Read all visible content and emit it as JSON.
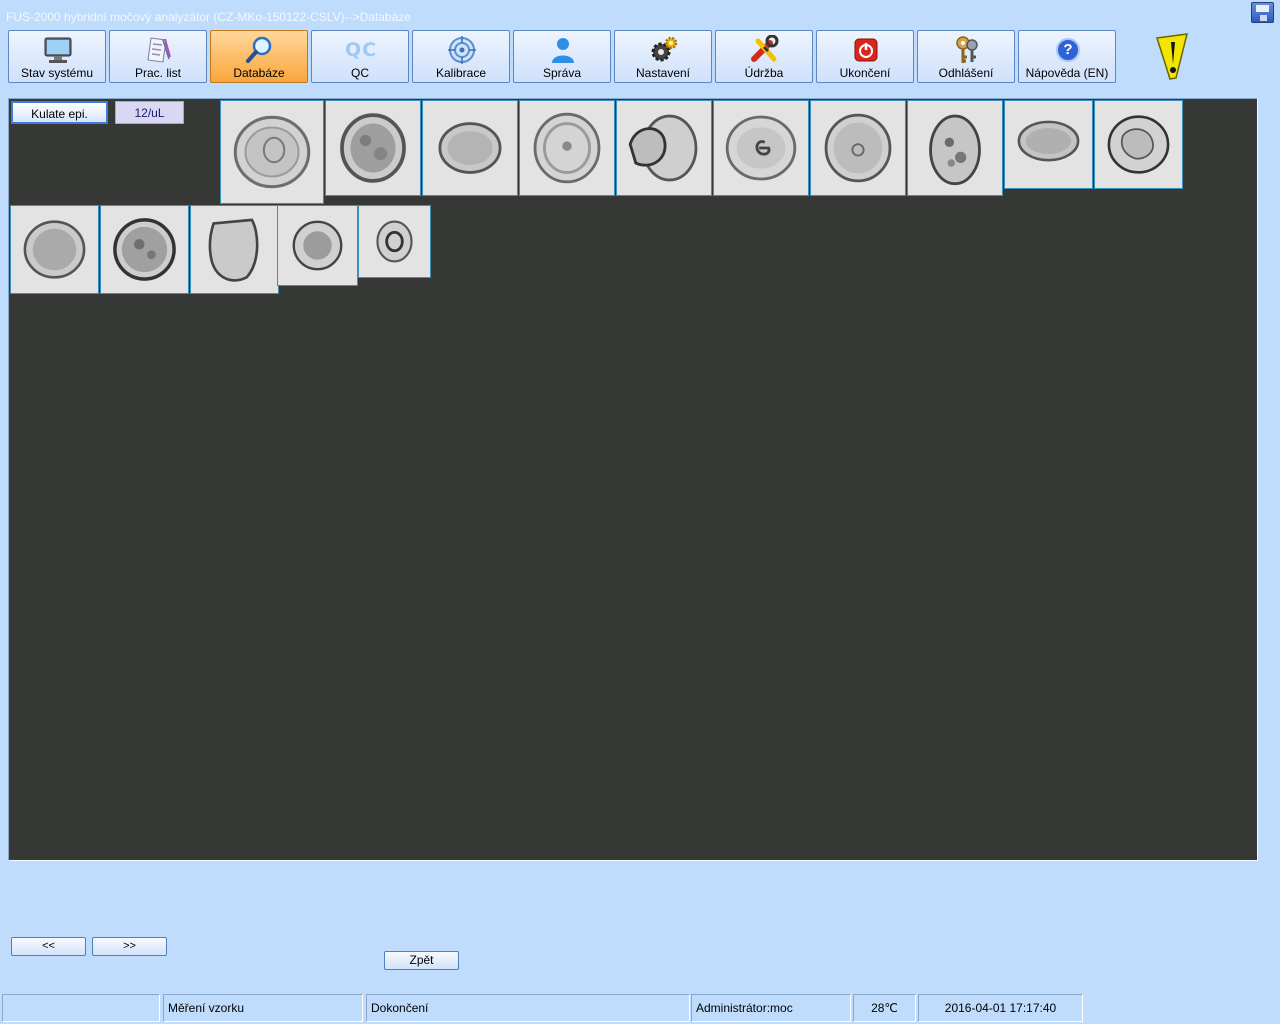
{
  "window": {
    "title": "FUS-2000 hybridní močový analyzátor (CZ-MKo-150122-CSLV)-->Databáze"
  },
  "toolbar": {
    "buttons": [
      {
        "label": "Stav systému",
        "icon": "monitor-icon"
      },
      {
        "label": "Prac. list",
        "icon": "worklist-icon"
      },
      {
        "label": "Databáze",
        "icon": "magnifier-icon",
        "active": true
      },
      {
        "label": "QC",
        "icon": "qc-icon"
      },
      {
        "label": "Kalibrace",
        "icon": "target-icon"
      },
      {
        "label": "Správa",
        "icon": "user-icon"
      },
      {
        "label": "Nastavení",
        "icon": "gears-icon"
      },
      {
        "label": "Údržba",
        "icon": "tools-icon"
      },
      {
        "label": "Ukončení",
        "icon": "power-icon"
      },
      {
        "label": "Odhlášení",
        "icon": "keys-icon"
      },
      {
        "label": "Nápověda (EN)",
        "icon": "help-icon"
      }
    ],
    "qc_glyph": "QC",
    "help_glyph": "?"
  },
  "category": {
    "name": "Kulate epi.",
    "count": "12/uL"
  },
  "navigation": {
    "prev_label": "<<",
    "next_label": ">>",
    "back_label": "Zpět"
  },
  "statusbar": {
    "cells": [
      "",
      "Měření vzorku",
      "Dokončení",
      "Administrátor:moc",
      "28℃",
      "2016-04-01 17:17:40"
    ]
  },
  "colors": {
    "window_bg": "#bfdcfd",
    "panel_bg": "#363835",
    "active_button": "#f9a63c",
    "thumb_border": "#3a8fbd"
  }
}
